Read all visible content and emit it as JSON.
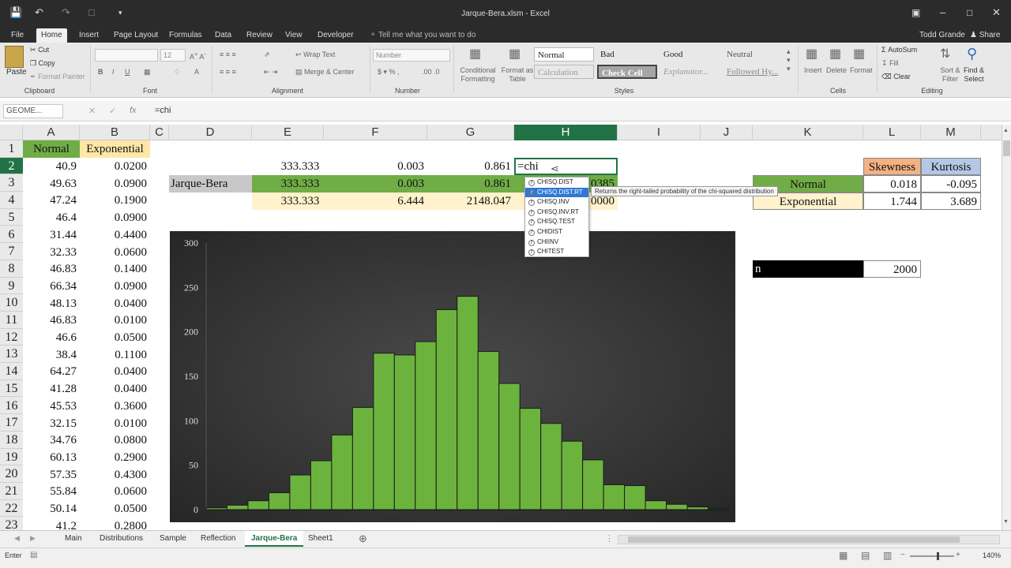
{
  "window": {
    "title": "Jarque-Bera.xlsm - Excel",
    "user": "Todd Grande",
    "share": "Share",
    "tell_me": "Tell me what you want to do"
  },
  "ribbon_tabs": [
    "File",
    "Home",
    "Insert",
    "Page Layout",
    "Formulas",
    "Data",
    "Review",
    "View",
    "Developer"
  ],
  "active_tab": "Home",
  "ribbon": {
    "clipboard": {
      "paste": "Paste",
      "cut": "Cut",
      "copy": "Copy",
      "format_painter": "Format Painter",
      "label": "Clipboard"
    },
    "font": {
      "name": "",
      "size": "12",
      "label": "Font"
    },
    "alignment": {
      "wrap": "Wrap Text",
      "merge": "Merge & Center",
      "label": "Alignment"
    },
    "number": {
      "format": "Number",
      "label": "Number"
    },
    "styles": {
      "conditional": "Conditional Formatting",
      "format_table": "Format as Table",
      "cells": [
        "Normal",
        "Bad",
        "Good",
        "Neutral",
        "Calculation",
        "Check Cell",
        "Explanator...",
        "Followed Hy..."
      ],
      "label": "Styles"
    },
    "cells": {
      "insert": "Insert",
      "delete": "Delete",
      "format": "Format",
      "label": "Cells"
    },
    "editing": {
      "autosum": "AutoSum",
      "fill": "Fill",
      "clear": "Clear",
      "sort": "Sort & Filter",
      "find": "Find & Select",
      "label": "Editing"
    }
  },
  "formula_bar": {
    "name_box": "GEOME...",
    "formula": "=chi"
  },
  "columns": [
    "A",
    "B",
    "C",
    "D",
    "E",
    "F",
    "G",
    "H",
    "I",
    "J",
    "K",
    "L",
    "M"
  ],
  "selected_column": "H",
  "rows": [
    "1",
    "2",
    "3",
    "4",
    "5",
    "6",
    "7",
    "8",
    "9",
    "10",
    "11",
    "12",
    "13",
    "14",
    "15",
    "16",
    "17",
    "18",
    "19",
    "20",
    "21",
    "22",
    "23"
  ],
  "selected_row": "2",
  "col_A_header": "Normal",
  "col_B_header": "Exponential",
  "col_A": [
    "40.9",
    "49.63",
    "47.24",
    "46.4",
    "31.44",
    "32.33",
    "46.83",
    "66.34",
    "48.13",
    "46.83",
    "46.6",
    "38.4",
    "64.27",
    "41.28",
    "45.53",
    "32.15",
    "34.76",
    "60.13",
    "57.35",
    "55.84",
    "50.14",
    "41.2"
  ],
  "col_B": [
    "0.0200",
    "0.0900",
    "0.1900",
    "0.0900",
    "0.4400",
    "0.0600",
    "0.1400",
    "0.0900",
    "0.0400",
    "0.0100",
    "0.0500",
    "0.1100",
    "0.0400",
    "0.0400",
    "0.3600",
    "0.0100",
    "0.0800",
    "0.2900",
    "0.4300",
    "0.0600",
    "0.0500",
    "0.2800"
  ],
  "jb": {
    "label": "Jarque-Bera",
    "row2": [
      "333.333",
      "0.003",
      "0.861"
    ],
    "row3": [
      "333.333",
      "0.003",
      "0.861"
    ],
    "row4": [
      "333.333",
      "6.444",
      "2148.047"
    ],
    "h2_editing": "=chi",
    "h3_partial": "0385",
    "h4_partial": "0000"
  },
  "stats": {
    "skewness": "Skewness",
    "kurtosis": "Kurtosis",
    "normal": "Normal",
    "exponential": "Exponential",
    "normal_skew": "0.018",
    "normal_kurt": "-0.095",
    "exp_skew": "1.744",
    "exp_kurt": "3.689",
    "n_label": "n",
    "n_value": "2000"
  },
  "autocomplete": {
    "items": [
      "CHISQ.DIST",
      "CHISQ.DIST.RT",
      "CHISQ.INV",
      "CHISQ.INV.RT",
      "CHISQ.TEST",
      "CHIDIST",
      "CHIINV",
      "CHITEST"
    ],
    "highlighted": 1,
    "tooltip": "Returns the right-tailed probability of the chi-squared distribution"
  },
  "chart_data": {
    "type": "bar",
    "title": "",
    "xlabel": "",
    "ylabel": "",
    "ylim": [
      0,
      300
    ],
    "yticks": [
      "0",
      "50",
      "100",
      "150",
      "200",
      "250",
      "300"
    ],
    "values": [
      2,
      5,
      10,
      19,
      39,
      55,
      84,
      115,
      176,
      174,
      189,
      225,
      240,
      178,
      142,
      114,
      97,
      77,
      56,
      28,
      27,
      10,
      6,
      3,
      1
    ],
    "color": "#6cb33e",
    "grid": false
  },
  "sheet_tabs": [
    "Main",
    "Distributions",
    "Sample",
    "Reflection",
    "Jarque-Bera",
    "Sheet1"
  ],
  "active_sheet": "Jarque-Bera",
  "status": {
    "mode": "Enter",
    "zoom": "140%"
  }
}
